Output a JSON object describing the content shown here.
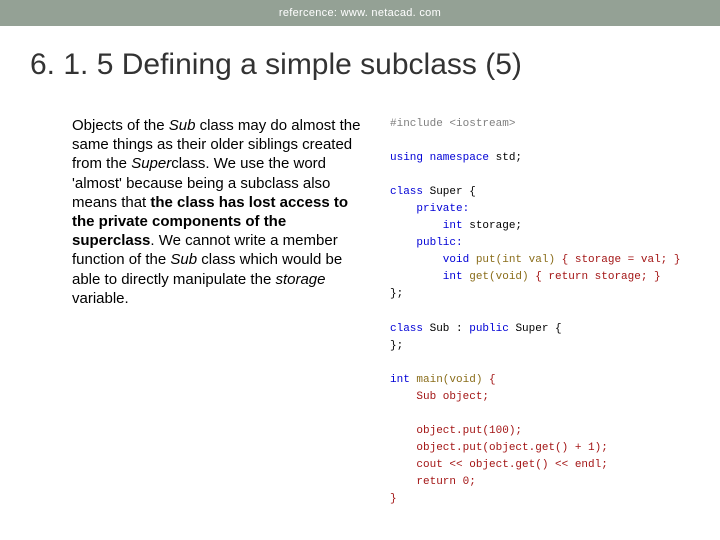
{
  "header": {
    "reference_label": "refercence: www. netacad. com"
  },
  "title": "6. 1. 5 Defining a simple subclass (5)",
  "body": {
    "p1a": "Objects of the ",
    "p1_sub1": "Sub",
    "p1b": " class may do almost the same things as their older siblings created from the ",
    "p1_super1": "Super",
    "p1c": "class. We use the word 'almost' because being a subclass also means that ",
    "p1_bold": "the class has lost access to the private components of the superclass",
    "p1d": ". We cannot write a member function of the ",
    "p1_sub2": "Sub",
    "p1e": " class which would be able to directly manipulate the ",
    "p1_storage": "storage",
    "p1f": " variable."
  },
  "code": {
    "l01_pre": "#include <iostream>",
    "l02_a": "using namespace ",
    "l02_b": "std;",
    "l03_a": "class ",
    "l03_b": "Super {",
    "l04": "    private:",
    "l05_a": "        int ",
    "l05_b": "storage;",
    "l06": "    public:",
    "l07_a": "        void ",
    "l07_b": "put(int val) ",
    "l07_c": "{ storage = val; }",
    "l08_a": "        int ",
    "l08_b": "get(void) ",
    "l08_c": "{ return storage; }",
    "l09": "};",
    "l10_a": "class ",
    "l10_b": "Sub : ",
    "l10_c": "public ",
    "l10_d": "Super {",
    "l11": "};",
    "l12_a": "int ",
    "l12_b": "main(void) ",
    "l12_c": "{",
    "l13": "    Sub object;",
    "l14": "    object.put(100);",
    "l15": "    object.put(object.get() + 1);",
    "l16": "    cout << object.get() << endl;",
    "l17": "    return 0;",
    "l18": "}"
  }
}
